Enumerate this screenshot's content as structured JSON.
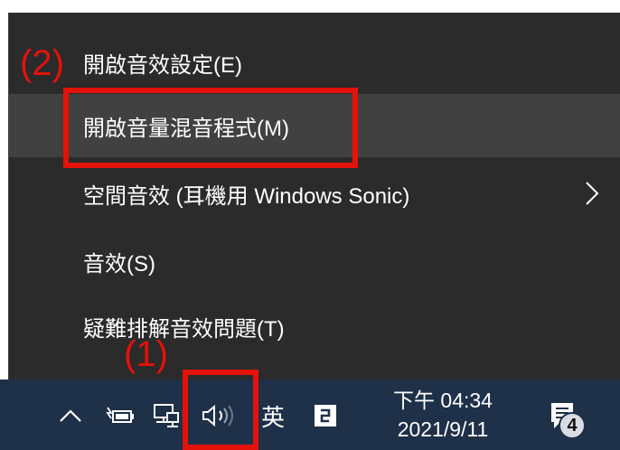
{
  "menu": {
    "items": [
      {
        "label": "開啟音效設定(E)"
      },
      {
        "label": "開啟音量混音程式(M)"
      },
      {
        "label": "空間音效 (耳機用 Windows Sonic)"
      },
      {
        "label": "音效(S)"
      },
      {
        "label": "疑難排解音效問題(T)"
      }
    ]
  },
  "annotations": {
    "step2": "(2)",
    "step1": "(1)",
    "color": "#e3120b"
  },
  "taskbar": {
    "ime_label": "英",
    "time": "下午 04:34",
    "date": "2021/9/11",
    "notification_count": "4",
    "icons": [
      "chevron-up-icon",
      "battery-icon",
      "network-icon",
      "volume-icon",
      "ime-mode-icon",
      "notification-icon"
    ]
  }
}
